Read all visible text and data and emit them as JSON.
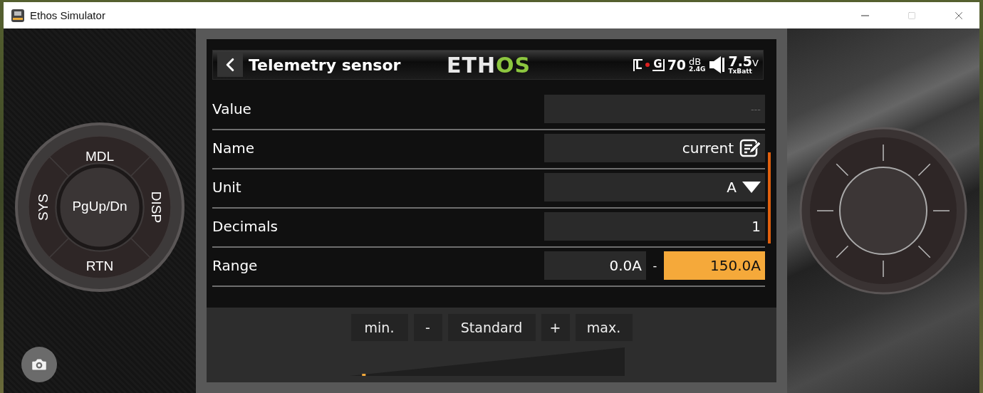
{
  "window": {
    "title": "Ethos Simulator"
  },
  "keypad": {
    "keys": [
      "MDL",
      "DISP",
      "RTN",
      "SYS"
    ],
    "center": "PgUp/Dn"
  },
  "screen": {
    "title": "Telemetry sensor",
    "logo": [
      {
        "text": "ETH",
        "color": "#e8e8e8"
      },
      {
        "text": "OS",
        "color": "#8cc63f"
      }
    ],
    "status": {
      "rx": "L",
      "gps": "G",
      "rssi": "70",
      "rssi_unit": "dB",
      "band": "2.4G",
      "battery": "7.5",
      "battery_unit": "V",
      "battery_label": "TxBatt"
    },
    "rows": [
      {
        "kind": "readonly",
        "label": "Value",
        "value": "---"
      },
      {
        "kind": "text",
        "label": "Name",
        "value": "current"
      },
      {
        "kind": "choice",
        "label": "Unit",
        "value": "A"
      },
      {
        "kind": "number",
        "label": "Decimals",
        "value": "1"
      },
      {
        "kind": "range",
        "label": "Range",
        "separator": "-",
        "fields": [
          {
            "value": "0.0A",
            "selected": false
          },
          {
            "value": "150.0A",
            "selected": true
          }
        ]
      }
    ]
  },
  "adjust_buttons": [
    "min.",
    "-",
    "Standard",
    "+",
    "max."
  ],
  "adjust_slider": {
    "level": 0.05
  }
}
